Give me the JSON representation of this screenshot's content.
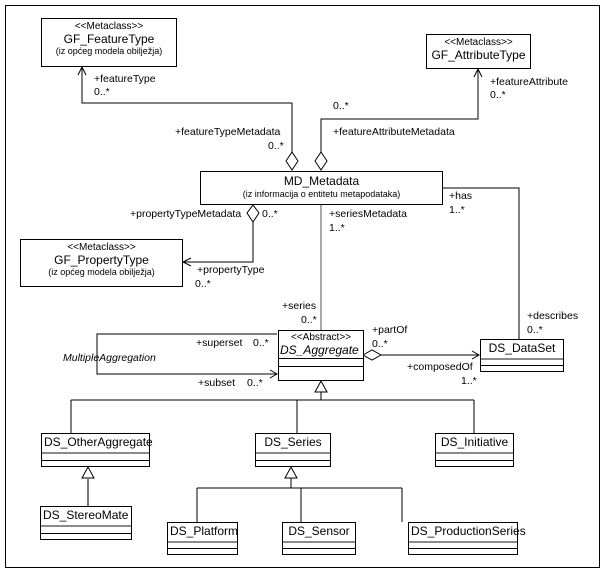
{
  "classes": {
    "gf_feature_type": {
      "stereotype": "<<Metaclass>>",
      "name": "GF_FeatureType",
      "note": "(iz općeg modela obilježja)"
    },
    "gf_attribute_type": {
      "stereotype": "<<Metaclass>>",
      "name": "GF_AttributeType"
    },
    "md_metadata": {
      "name": "MD_Metadata",
      "note": "(iz informacija o entitetu metapodataka)"
    },
    "gf_property_type": {
      "stereotype": "<<Metaclass>>",
      "name": "GF_PropertyType",
      "note": "(iz općeg modela obilježja)"
    },
    "ds_aggregate": {
      "stereotype": "<<Abstract>>",
      "name": "DS_Aggregate"
    },
    "ds_dataset": {
      "name": "DS_DataSet"
    },
    "ds_other_aggregate": {
      "name": "DS_OtherAggregate"
    },
    "ds_series": {
      "name": "DS_Series"
    },
    "ds_initiative": {
      "name": "DS_Initiative"
    },
    "ds_stereomate": {
      "name": "DS_StereoMate"
    },
    "ds_platform": {
      "name": "DS_Platform"
    },
    "ds_sensor": {
      "name": "DS_Sensor"
    },
    "ds_production_series": {
      "name": "DS_ProductionSeries"
    }
  },
  "roles": {
    "feature_type": "+featureType",
    "feature_type_mult": "0..*",
    "feature_type_metadata": "+featureTypeMetadata",
    "feature_type_metadata_mult": "0..*",
    "feature_attribute": "+featureAttribute",
    "feature_attribute_mult": "0..*",
    "feature_attribute_metadata": "+featureAttributeMetadata",
    "feature_attribute_metadata_mult": "0..*",
    "property_type_metadata": "+propertyTypeMetadata",
    "property_type_metadata_mult": "0..*",
    "property_type": "+propertyType",
    "property_type_mult": "0..*",
    "series_metadata": "+seriesMetadata",
    "series_metadata_mult": "1..*",
    "has": "+has",
    "has_mult": "1..*",
    "series": "+series",
    "series_mult": "0..*",
    "describes": "+describes",
    "describes_mult": "0..*",
    "superset": "+superset",
    "superset_mult": "0..*",
    "subset": "+subset",
    "subset_mult": "0..*",
    "part_of": "+partOf",
    "part_of_mult": "0..*",
    "composed_of": "+composedOf",
    "composed_of_mult": "1..*",
    "association_name": "MultipleAggregation"
  }
}
